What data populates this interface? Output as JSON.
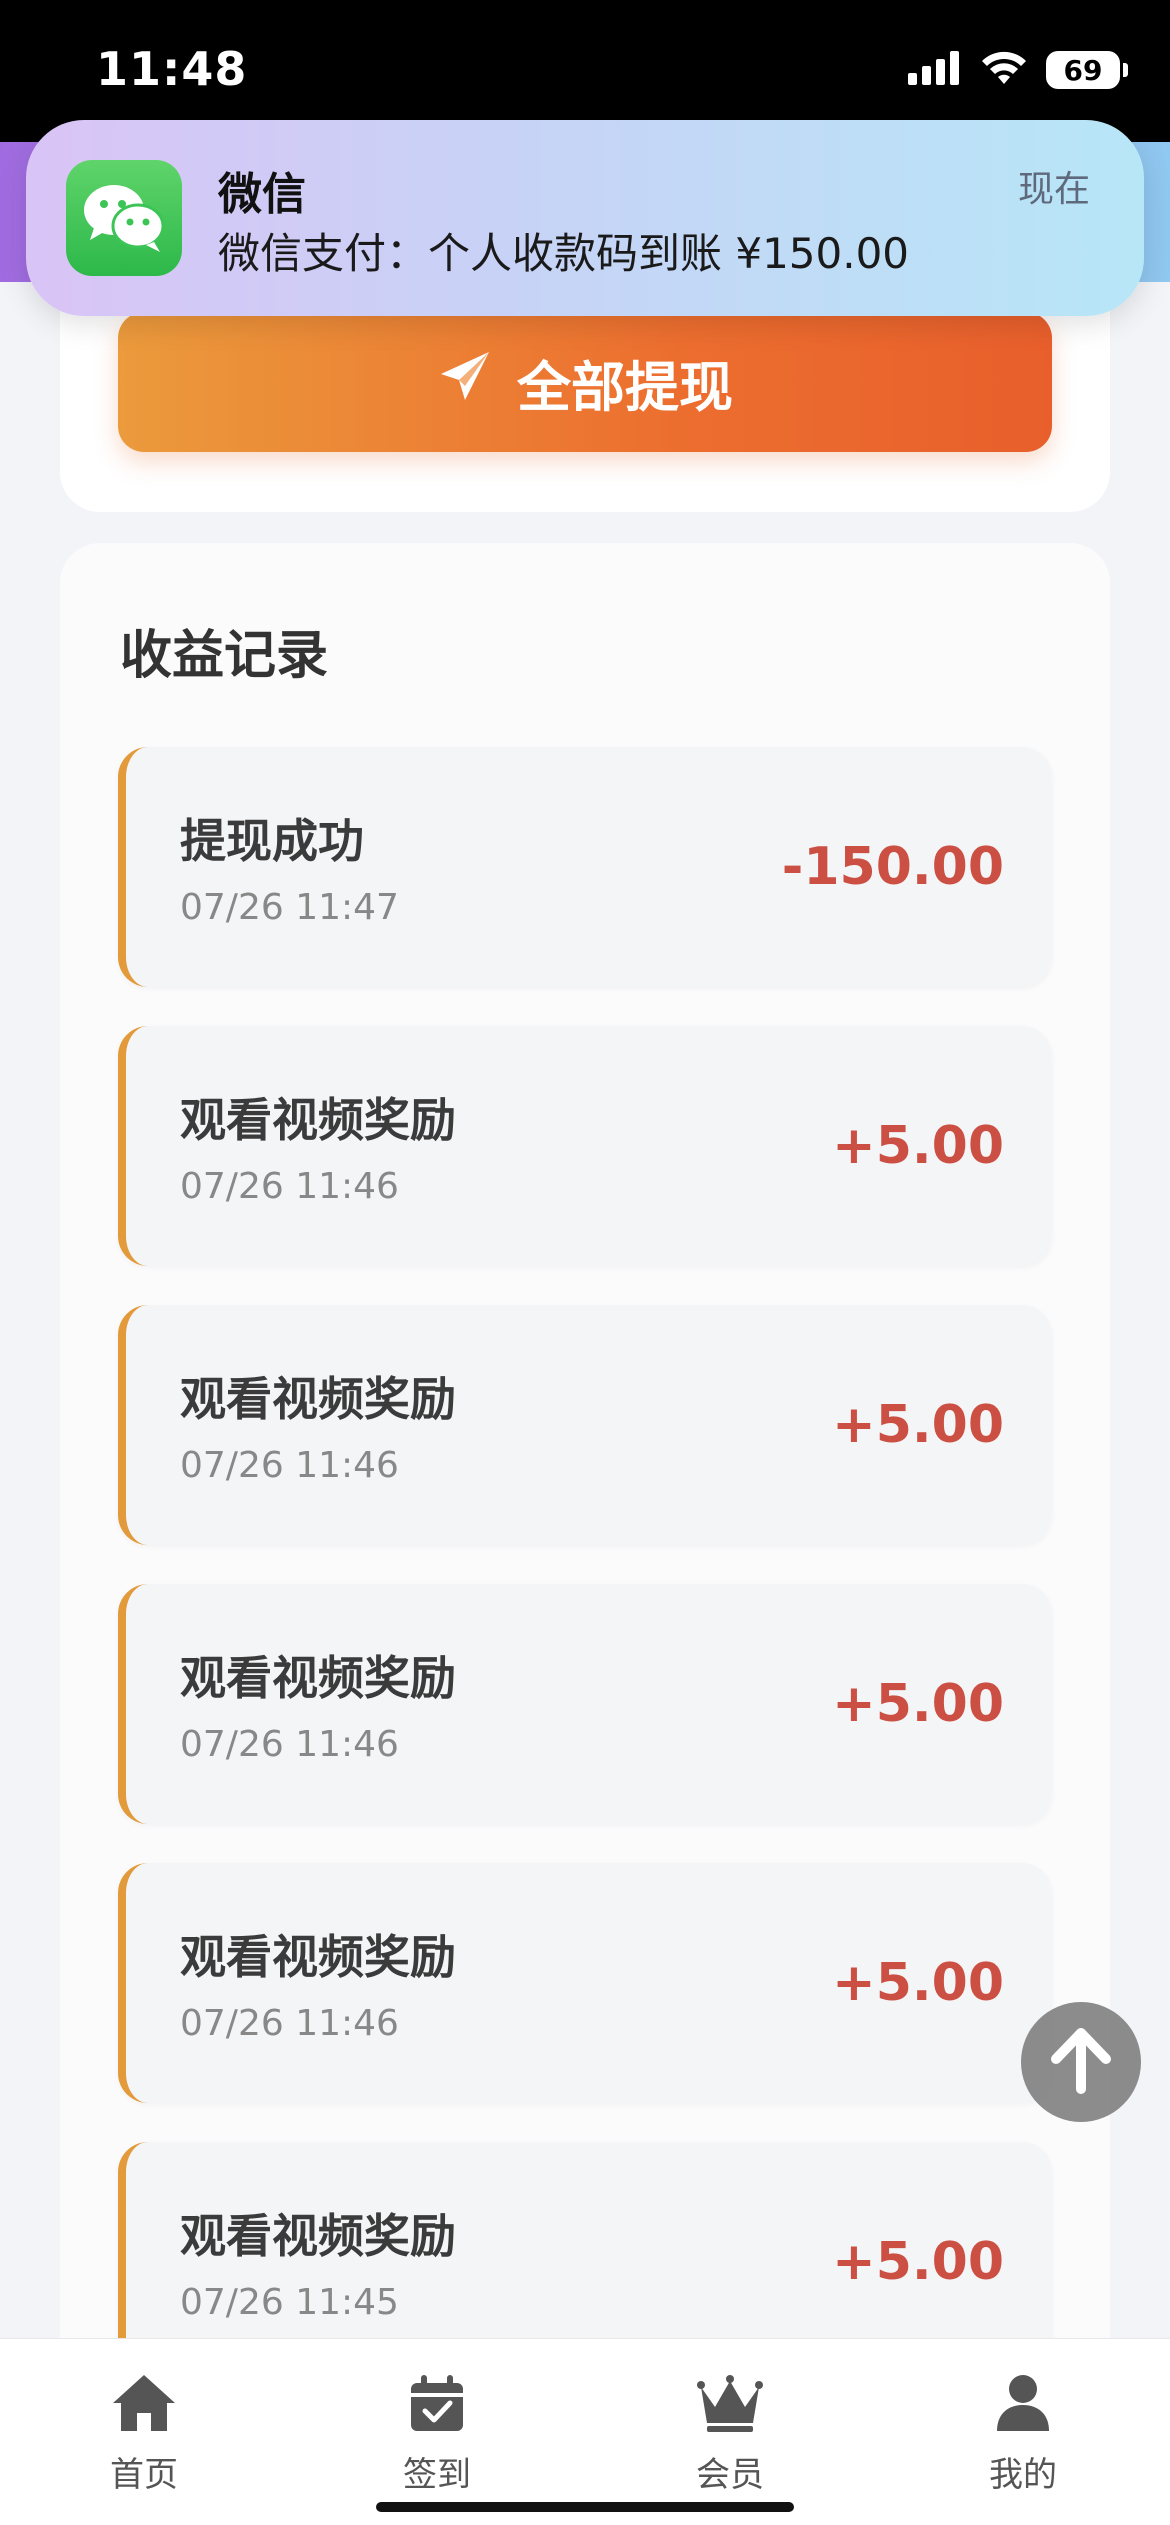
{
  "status_bar": {
    "time": "11:48",
    "battery": "69"
  },
  "notification": {
    "app_name": "微信",
    "message": "微信支付：个人收款码到账 ¥150.00",
    "time": "现在",
    "icon": "wechat-icon"
  },
  "withdraw": {
    "button_label": "全部提现",
    "icon": "paper-plane-icon"
  },
  "records": {
    "title": "收益记录",
    "items": [
      {
        "title": "提现成功",
        "time": "07/26 11:47",
        "amount": "-150.00"
      },
      {
        "title": "观看视频奖励",
        "time": "07/26 11:46",
        "amount": "+5.00"
      },
      {
        "title": "观看视频奖励",
        "time": "07/26 11:46",
        "amount": "+5.00"
      },
      {
        "title": "观看视频奖励",
        "time": "07/26 11:46",
        "amount": "+5.00"
      },
      {
        "title": "观看视频奖励",
        "time": "07/26 11:46",
        "amount": "+5.00"
      },
      {
        "title": "观看视频奖励",
        "time": "07/26 11:45",
        "amount": "+5.00"
      }
    ]
  },
  "tabs": [
    {
      "label": "首页",
      "icon": "home-icon"
    },
    {
      "label": "签到",
      "icon": "calendar-check-icon"
    },
    {
      "label": "会员",
      "icon": "crown-icon"
    },
    {
      "label": "我的",
      "icon": "user-icon"
    }
  ],
  "colors": {
    "accent_orange": "#ec6e2f",
    "amount_red": "#cc4f43",
    "record_border": "#e29a3a"
  }
}
